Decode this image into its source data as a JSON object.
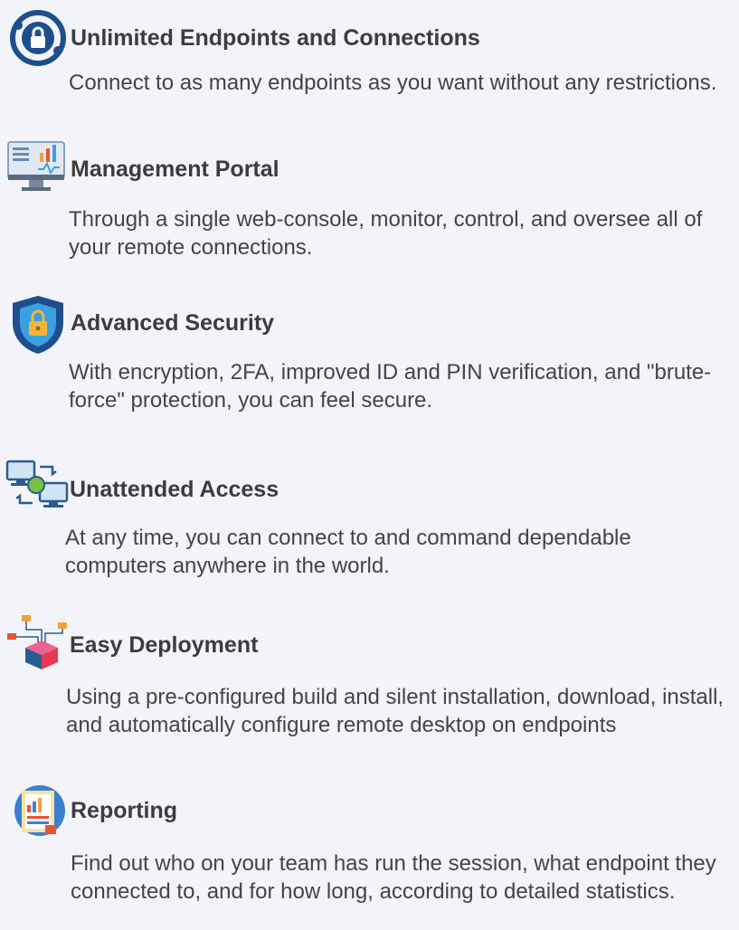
{
  "features": [
    {
      "icon": "globe-lock-icon",
      "title": "Unlimited Endpoints and Connections",
      "description": "Connect to as many endpoints as you want without any restrictions."
    },
    {
      "icon": "monitor-chart-icon",
      "title": "Management Portal",
      "description": "Through a single web-console, monitor, control, and oversee all of your remote connections."
    },
    {
      "icon": "shield-lock-icon",
      "title": "Advanced Security",
      "description": "With encryption, 2FA, improved ID and PIN verification, and \"brute-force\" protection, you can feel secure."
    },
    {
      "icon": "remote-computers-icon",
      "title": "Unattended Access",
      "description": "At any time, you can connect to and command dependable computers anywhere in the world."
    },
    {
      "icon": "deployment-box-icon",
      "title": "Easy Deployment",
      "description": "Using a pre-configured build and silent installation, download, install, and automatically configure remote desktop on endpoints"
    },
    {
      "icon": "report-icon",
      "title": "Reporting",
      "description": "Find out who on your team has run the session, what endpoint they connected to, and for how long, according to detailed statistics."
    }
  ]
}
